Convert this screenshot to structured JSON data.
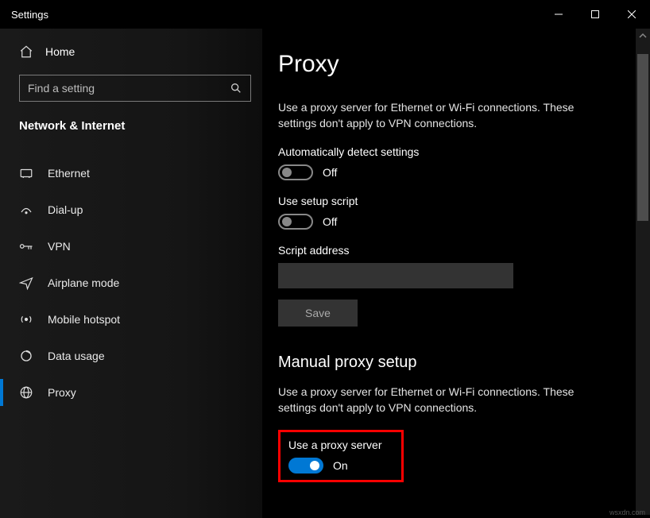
{
  "window": {
    "title": "Settings"
  },
  "sidebar": {
    "home": "Home",
    "search_placeholder": "Find a setting",
    "category": "Network & Internet",
    "items": [
      {
        "label": "Ethernet"
      },
      {
        "label": "Dial-up"
      },
      {
        "label": "VPN"
      },
      {
        "label": "Airplane mode"
      },
      {
        "label": "Mobile hotspot"
      },
      {
        "label": "Data usage"
      },
      {
        "label": "Proxy"
      }
    ]
  },
  "main": {
    "page_title": "Proxy",
    "auto_desc": "Use a proxy server for Ethernet or Wi-Fi connections. These settings don't apply to VPN connections.",
    "auto_detect_label": "Automatically detect settings",
    "auto_detect_state": "Off",
    "use_script_label": "Use setup script",
    "use_script_state": "Off",
    "script_addr_label": "Script address",
    "script_addr_value": "",
    "save_label": "Save",
    "manual_title": "Manual proxy setup",
    "manual_desc": "Use a proxy server for Ethernet or Wi-Fi connections. These settings don't apply to VPN connections.",
    "use_proxy_label": "Use a proxy server",
    "use_proxy_state": "On"
  },
  "watermark": "wsxdn.com"
}
